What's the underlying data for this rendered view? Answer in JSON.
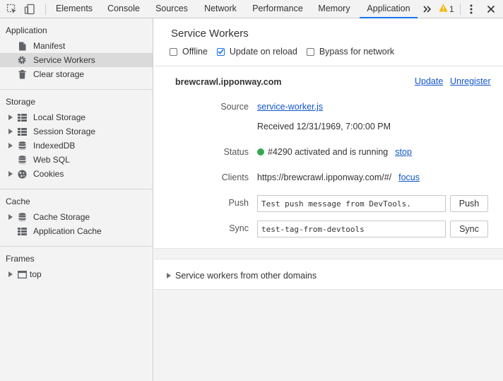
{
  "toolbar": {
    "tabs": [
      {
        "label": "Elements",
        "active": false
      },
      {
        "label": "Console",
        "active": false
      },
      {
        "label": "Sources",
        "active": false
      },
      {
        "label": "Network",
        "active": false
      },
      {
        "label": "Performance",
        "active": false
      },
      {
        "label": "Memory",
        "active": false
      },
      {
        "label": "Application",
        "active": true
      }
    ],
    "overflow_icon": "chevron-double-right-icon",
    "warning_count": "1",
    "icons": [
      "inspect-element-icon",
      "device-toolbar-icon",
      "warning-icon",
      "kebab-menu-icon",
      "close-icon"
    ],
    "accent_color": "#1a73e8"
  },
  "sidebar": {
    "application": {
      "title": "Application",
      "items": [
        {
          "label": "Manifest",
          "icon": "document-icon"
        },
        {
          "label": "Service Workers",
          "icon": "gear-icon",
          "selected": true
        },
        {
          "label": "Clear storage",
          "icon": "trash-icon"
        }
      ]
    },
    "storage": {
      "title": "Storage",
      "items": [
        {
          "label": "Local Storage",
          "icon": "table-icon",
          "expandable": true
        },
        {
          "label": "Session Storage",
          "icon": "table-icon",
          "expandable": true
        },
        {
          "label": "IndexedDB",
          "icon": "database-icon",
          "expandable": true
        },
        {
          "label": "Web SQL",
          "icon": "database-icon",
          "expandable": false
        },
        {
          "label": "Cookies",
          "icon": "cookie-icon",
          "expandable": true
        }
      ]
    },
    "cache": {
      "title": "Cache",
      "items": [
        {
          "label": "Cache Storage",
          "icon": "database-icon",
          "expandable": true
        },
        {
          "label": "Application Cache",
          "icon": "table-icon",
          "expandable": false
        }
      ]
    },
    "frames": {
      "title": "Frames",
      "items": [
        {
          "label": "top",
          "icon": "frame-icon",
          "expandable": true
        }
      ]
    }
  },
  "main": {
    "title": "Service Workers",
    "options": {
      "offline": {
        "label": "Offline",
        "checked": false
      },
      "update_on_reload": {
        "label": "Update on reload",
        "checked": true
      },
      "bypass": {
        "label": "Bypass for network",
        "checked": false
      }
    },
    "worker": {
      "origin": "brewcrawl.ipponway.com",
      "update_label": "Update",
      "unregister_label": "Unregister",
      "source_label": "Source",
      "source_file": "service-worker.js",
      "received": "Received 12/31/1969, 7:00:00 PM",
      "status_label": "Status",
      "status_text": "#4290 activated and is running",
      "status_color": "#34a853",
      "stop_label": "stop",
      "clients_label": "Clients",
      "client_url": "https://brewcrawl.ipponway.com/#/",
      "focus_label": "focus",
      "push_label": "Push",
      "push_value": "Test push message from DevTools.",
      "push_button": "Push",
      "sync_label": "Sync",
      "sync_value": "test-tag-from-devtools",
      "sync_button": "Sync"
    },
    "other_domains": "Service workers from other domains"
  }
}
